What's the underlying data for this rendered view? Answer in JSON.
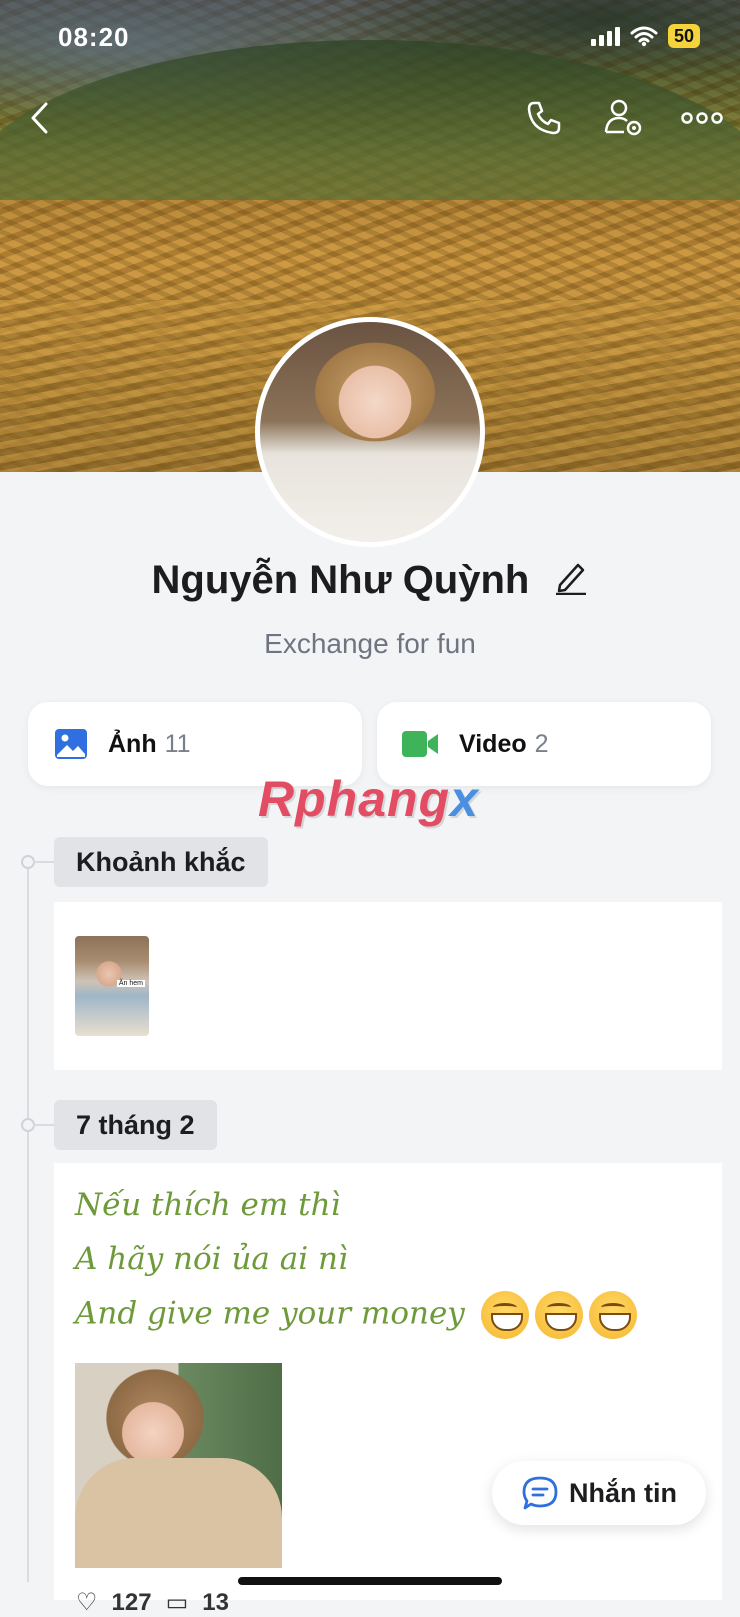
{
  "status_bar": {
    "time": "08:20",
    "battery": "50"
  },
  "profile": {
    "name": "Nguyễn Như Quỳnh",
    "bio": "Exchange for fun"
  },
  "media_tiles": [
    {
      "label": "Ảnh",
      "count": "11",
      "icon": "photo-icon",
      "color": "#2f6fe0"
    },
    {
      "label": "Video",
      "count": "2",
      "icon": "video-icon",
      "color": "#3fb35a"
    }
  ],
  "watermark": {
    "part1": "Rphang",
    "part2": "x"
  },
  "sections": {
    "moments_label": "Khoảnh khắc",
    "moment_thumb_tag": "Ăn hem",
    "date_label": "7 tháng 2"
  },
  "post": {
    "lines": [
      "Nếu thích em thì",
      "A hãy nói ủa ai nì",
      "And give me your money"
    ]
  },
  "message_button": {
    "label": "Nhắn tin"
  },
  "post_stats": {
    "likes": "127",
    "comments": "13"
  }
}
